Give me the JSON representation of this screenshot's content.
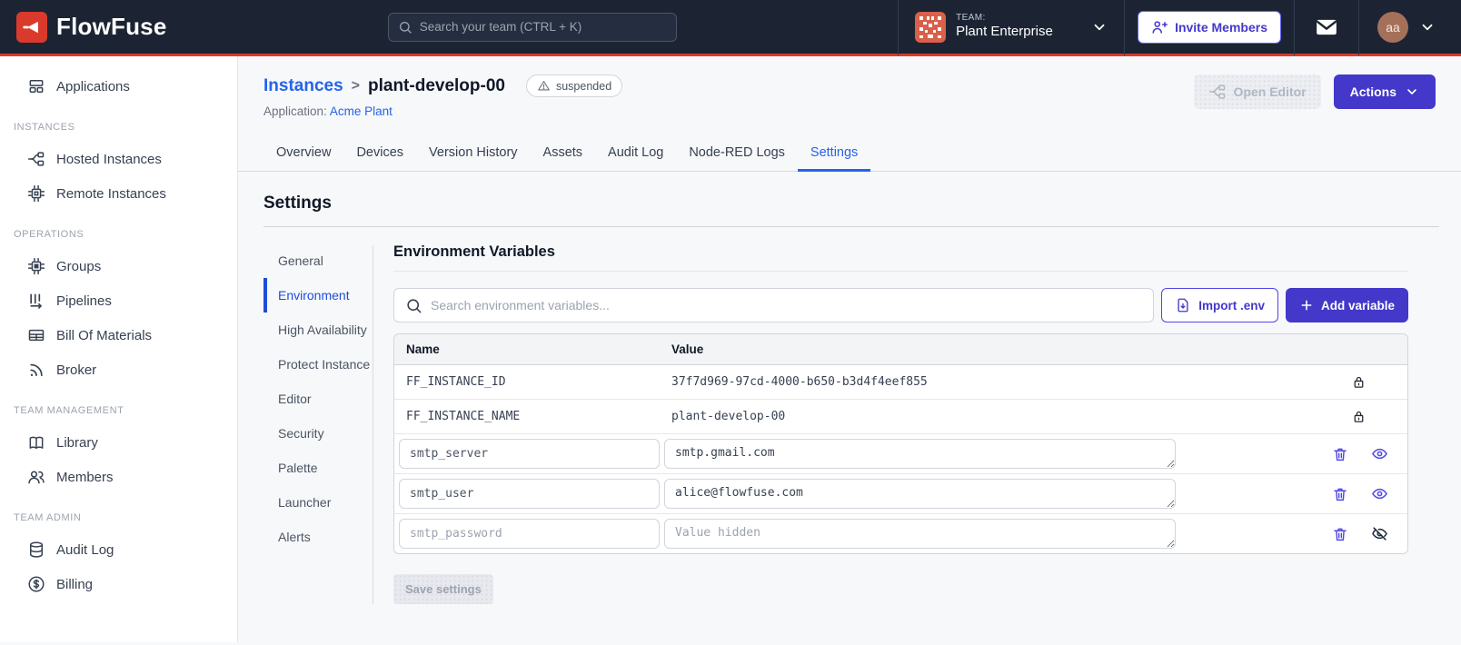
{
  "colors": {
    "header_bg": "#1c2433",
    "brand_red": "#d93a2b",
    "indigo": "#4338ca",
    "link_blue": "#2563eb",
    "active_subnav_blue": "#1d4ed8"
  },
  "header": {
    "brand": "FlowFuse",
    "search_placeholder": "Search your team (CTRL + K)",
    "team_label": "TEAM:",
    "team_name": "Plant Enterprise",
    "invite_button": "Invite Members",
    "avatar_initials": "aa"
  },
  "sidebar": {
    "applications": "Applications",
    "sections": [
      {
        "title": "INSTANCES",
        "items": [
          "Hosted Instances",
          "Remote Instances"
        ]
      },
      {
        "title": "OPERATIONS",
        "items": [
          "Groups",
          "Pipelines",
          "Bill Of Materials",
          "Broker"
        ]
      },
      {
        "title": "TEAM MANAGEMENT",
        "items": [
          "Library",
          "Members"
        ]
      },
      {
        "title": "TEAM ADMIN",
        "items": [
          "Audit Log",
          "Billing"
        ]
      }
    ]
  },
  "page": {
    "breadcrumb_parent": "Instances",
    "breadcrumb_sep": ">",
    "breadcrumb_current": "plant-develop-00",
    "status_badge": "suspended",
    "application_label": "Application:",
    "application_name": "Acme Plant",
    "open_editor_button": "Open Editor",
    "actions_button": "Actions"
  },
  "tabs": [
    "Overview",
    "Devices",
    "Version History",
    "Assets",
    "Audit Log",
    "Node-RED Logs",
    "Settings"
  ],
  "settings": {
    "title": "Settings",
    "subnav": [
      "General",
      "Environment",
      "High Availability",
      "Protect Instance",
      "Editor",
      "Security",
      "Palette",
      "Launcher",
      "Alerts"
    ],
    "active_subnav": "Environment"
  },
  "env": {
    "heading": "Environment Variables",
    "search_placeholder": "Search environment variables...",
    "import_button": "Import .env",
    "add_button": "Add variable",
    "col_name": "Name",
    "col_value": "Value",
    "locked_rows": [
      {
        "name": "FF_INSTANCE_ID",
        "value": "37f7d969-97cd-4000-b650-b3d4f4eef855"
      },
      {
        "name": "FF_INSTANCE_NAME",
        "value": "plant-develop-00"
      }
    ],
    "editable_rows": [
      {
        "name": "smtp_server",
        "value": "smtp.gmail.com"
      },
      {
        "name": "smtp_user",
        "value": "alice@flowfuse.com"
      },
      {
        "name": "smtp_password",
        "value": "",
        "value_placeholder": "Value hidden"
      }
    ],
    "save_button": "Save settings"
  }
}
